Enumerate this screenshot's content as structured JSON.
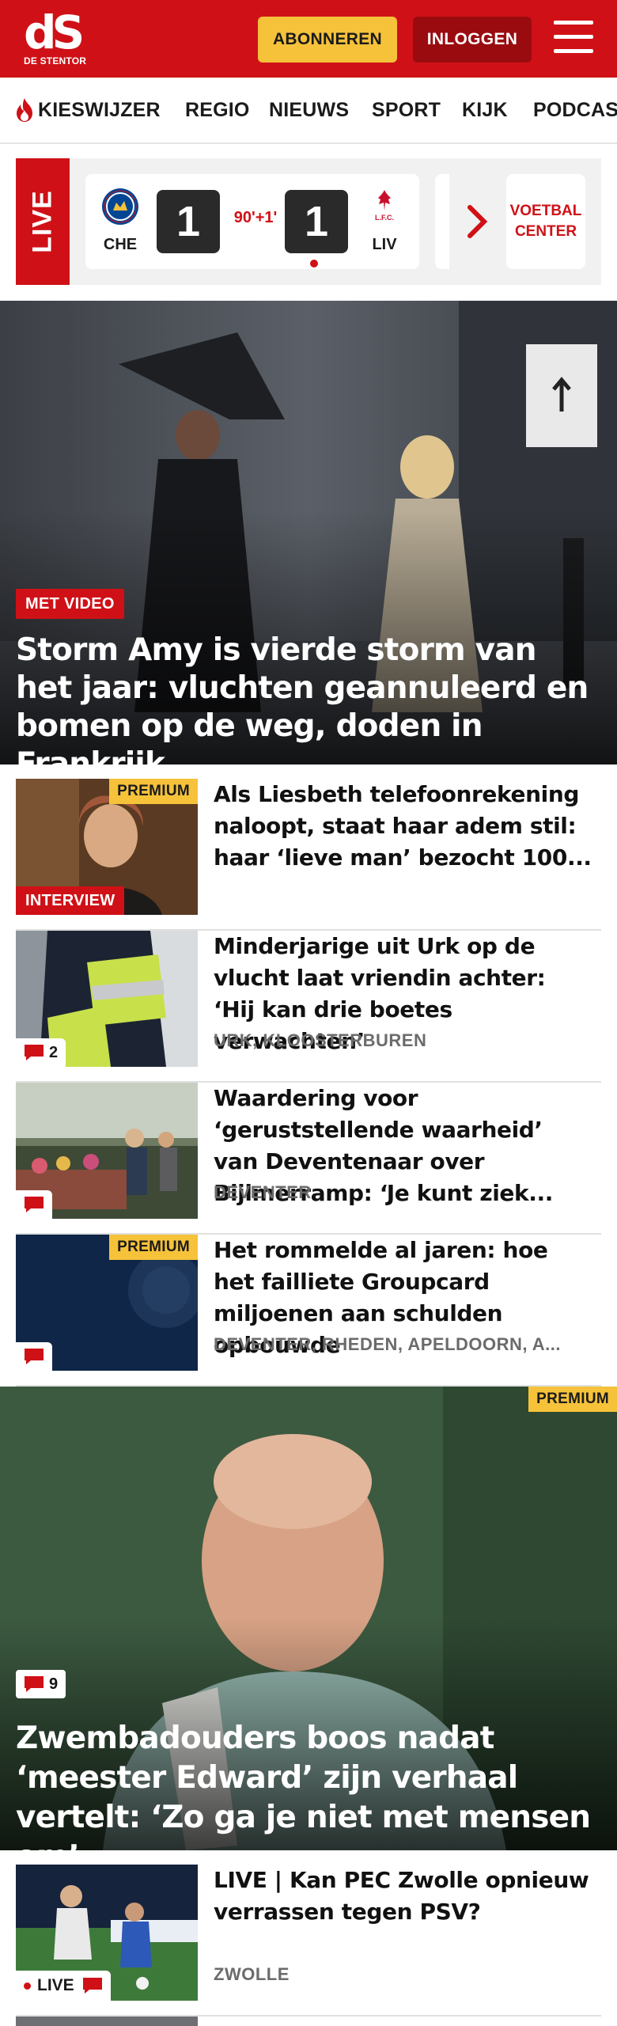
{
  "header": {
    "logo_text": "dS",
    "logo_sub": "DE STENTOR",
    "subscribe_label": "ABONNEREN",
    "login_label": "INLOGGEN",
    "menu_icon": "hamburger-icon",
    "brand_color": "#cf1117",
    "accent_color": "#f5c23a"
  },
  "nav": {
    "items": [
      {
        "label": "KIESWIJZER",
        "icon": "flame-icon"
      },
      {
        "label": "REGIO"
      },
      {
        "label": "NIEUWS"
      },
      {
        "label": "SPORT"
      },
      {
        "label": "KIJK"
      },
      {
        "label": "PODCAST"
      }
    ]
  },
  "live": {
    "tag": "LIVE",
    "home_team": "CHE",
    "away_team": "LIV",
    "home_score": "1",
    "away_score": "1",
    "minute": "90'+1'",
    "center_button": "VOETBAL CENTER"
  },
  "hero": {
    "badge": "MET VIDEO",
    "title": "Storm Amy is vierde storm van het jaar: vluchten geannuleerd en bomen op de weg, doden in Frankrijk"
  },
  "articles": [
    {
      "title": "Als Liesbeth telefoonrekening naloopt, staat haar adem stil: haar ‘lieve man’ bezocht 100...",
      "premium": "PREMIUM",
      "label": "INTERVIEW",
      "meta": ""
    },
    {
      "title": "Minderjarige uit Urk op de vlucht laat vriendin achter: ‘Hij kan drie boetes verwachten’",
      "meta": "URK, KLOOSTERBUREN",
      "comments": "2"
    },
    {
      "title": "Waardering voor ‘geruststellen­de waarheid’ van Deventenaar over Bijlmerramp: ‘Je kunt ziek...",
      "meta": "DEVENTER",
      "comments": ""
    },
    {
      "title": "Het rommelde al jaren: hoe het failliete Groupcard miljoenen aan schulden opbouwde",
      "meta": "DEVENTER, RHEDEN, APELDOORN, A...",
      "premium": "PREMIUM",
      "comments": ""
    }
  ],
  "feature": {
    "premium": "PREMIUM",
    "comments": "9",
    "title": "Zwembadouders boos nadat ‘meester Edward’ zijn verhaal vertelt: ‘Zo ga je niet met mensen om’"
  },
  "live_article": {
    "title": "LIVE | Kan PEC Zwolle opnieuw verrassen tegen PSV?",
    "meta": "ZWOLLE",
    "live_label": "LIVE"
  }
}
